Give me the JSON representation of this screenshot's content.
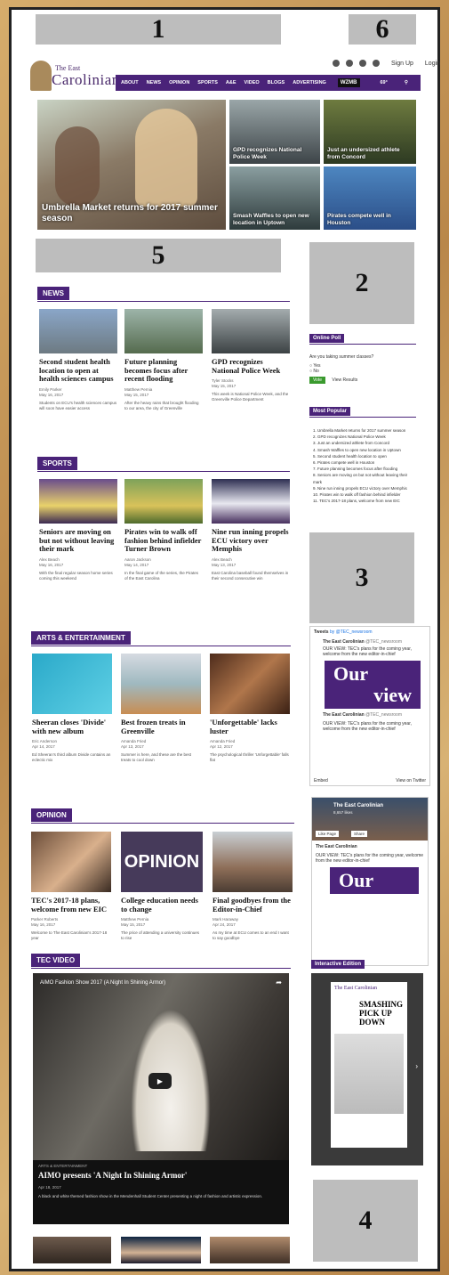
{
  "annotations": {
    "box1": "1",
    "box2": "2",
    "box3": "3",
    "box4": "4",
    "box5": "5",
    "box6": "6"
  },
  "topbar": {
    "signup": "Sign Up",
    "login": "Login"
  },
  "logo": {
    "line1": "The East",
    "line2": "Carolinian"
  },
  "nav": {
    "items": [
      "ABOUT",
      "NEWS",
      "OPINION",
      "SPORTS",
      "A&E",
      "VIDEO",
      "BLOGS",
      "ADVERTISING"
    ],
    "radio": "WZMB",
    "weather": "69°"
  },
  "hero": {
    "main": "Umbrella Market returns for 2017 summer season",
    "t1": "GPD recognizes National Police Week",
    "t2": "Just an undersized athlete from Concord",
    "t3": "Smash Waffles to open new location in Uptown",
    "t4": "Pirates compete well in Houston"
  },
  "news": {
    "title": "NEWS",
    "items": [
      {
        "h": "Second student health location to open at health sciences campus",
        "by": "Emily Parker",
        "date": "May 16, 2017",
        "ex": "Students on ECU's health sciences campus will soon have easier access"
      },
      {
        "h": "Future planning becomes focus after recent flooding",
        "by": "Matthew Pernia",
        "date": "May 15, 2017",
        "ex": "After the heavy rains that brought flooding to our area, the city of Greenville"
      },
      {
        "h": "GPD recognizes National Police Week",
        "by": "Tyler Stocks",
        "date": "May 15, 2017",
        "ex": "This week is National Police Week, and the Greenville Police Department"
      }
    ]
  },
  "sports": {
    "title": "SPORTS",
    "items": [
      {
        "h": "Seniors are moving on but not without leaving their mark",
        "by": "Alex Beach",
        "date": "May 16, 2017",
        "ex": "With the final regular season home series coming this weekend"
      },
      {
        "h": "Pirates win to walk off fashion behind infielder Turner Brown",
        "by": "Aaron Jackson",
        "date": "May 14, 2017",
        "ex": "In the final game of the series, the Pirates of the East Carolina"
      },
      {
        "h": "Nine run inning propels ECU victory over Memphis",
        "by": "Alex Beach",
        "date": "May 13, 2017",
        "ex": "East Carolina baseball found themselves in their second consecutive win"
      }
    ]
  },
  "ae": {
    "title": "ARTS & ENTERTAINMENT",
    "items": [
      {
        "h": "Sheeran closes 'Divide' with new album",
        "by": "Eric Anderson",
        "date": "Apr 14, 2017",
        "ex": "Ed Sheeran's third album Divide contains an eclectic mix"
      },
      {
        "h": "Best frozen treats in Greenville",
        "by": "Amanda Fried",
        "date": "Apr 13, 2017",
        "ex": "Summer is here, and these are the best treats to cool down"
      },
      {
        "h": "'Unforgettable' lacks luster",
        "by": "Amanda Fried",
        "date": "Apr 12, 2017",
        "ex": "The psychological thriller 'Unforgettable' falls flat"
      }
    ]
  },
  "opinion": {
    "title": "OPINION",
    "items": [
      {
        "h": "TEC's 2017-18 plans, welcome from new EIC",
        "by": "Parker Roberts",
        "date": "May 16, 2017",
        "ex": "Welcome to The East Carolinian's 2017-18 year"
      },
      {
        "h": "College education needs to change",
        "by": "Matthew Pernia",
        "date": "May 15, 2017",
        "ex": "The price of attending a university continues to rise"
      },
      {
        "h": "Final goodbyes from the Editor-in-Chief",
        "by": "Mark Haraway",
        "date": "Apr 24, 2017",
        "ex": "As my time at ECU comes to an end I want to say goodbye"
      }
    ],
    "graphic": "OPINION"
  },
  "video": {
    "title": "TEC VIDEO",
    "player_title": "AIMO Fashion Show 2017 (A Night In Shining Armor)",
    "category": "ARTS & ENTERTAINMENT",
    "headline": "AIMO presents 'A Night In Shining Armor'",
    "meta": "Apr 18, 2017",
    "desc": "A black and white themed fashion show in the Mendenhall Student Center presenting a night of fashion and artistic expression."
  },
  "sidebar": {
    "poll_title": "Online Poll",
    "poll_q": "Are you taking summer classes?",
    "poll_opts": [
      "Yes",
      "No"
    ],
    "vote": "Vote",
    "results": "View Results",
    "popular_title": "Most Popular",
    "popular": [
      "Umbrella Market returns for 2017 summer season",
      "GPD recognizes National Police Week",
      "Just an undersized athlete from Concord",
      "Smash Waffles to open new location in Uptown",
      "Second student health location to open",
      "Pirates compete well in Houston",
      "Future planning becomes focus after flooding",
      "Seniors are moving on but not without leaving their mark",
      "Nine run inning propels ECU victory over Memphis",
      "Pirates win to walk off fashion behind infielder",
      "TEC's 2017-18 plans, welcome from new EIC"
    ],
    "tweets_title": "Tweets",
    "tweets_by": "by @TEC_newsroom",
    "tw_name": "The East Carolinian",
    "tw_handle": "@TEC_newsroom",
    "tw_text": "OUR VIEW: TEC's plans for the coming year, welcome from the new editor-in-chief",
    "our": "Our",
    "view": "view",
    "embed": "Embed",
    "view_twitter": "View on Twitter",
    "fb_name": "The East Carolinian",
    "fb_likes": "8,657 likes",
    "fb_like": "Like Page",
    "fb_share": "Share",
    "edition_title": "Interactive Edition",
    "edition_headline": "SMASHING PICK UP DOWN",
    "edition_brand": "The East Carolinian"
  }
}
